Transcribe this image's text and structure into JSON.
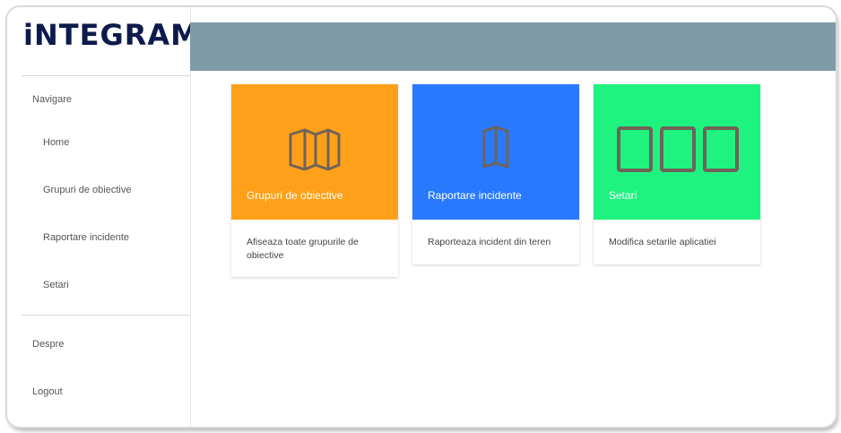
{
  "logo": {
    "text": "iNTEGRAM"
  },
  "sidebar": {
    "section_label": "Navigare",
    "items": [
      {
        "label": "Home"
      },
      {
        "label": "Grupuri de obiective"
      },
      {
        "label": "Raportare incidente"
      },
      {
        "label": "Setari"
      }
    ],
    "bottom_items": [
      {
        "label": "Despre"
      },
      {
        "label": "Logout"
      }
    ]
  },
  "cards": [
    {
      "title": "Grupuri de obiective",
      "description": "Afiseaza toate grupurile de obiective",
      "color": "#ffa01a",
      "icon": "map-icon"
    },
    {
      "title": "Raportare incidente",
      "description": "Raporteaza incident din teren",
      "color": "#2979ff",
      "icon": "map-marker-icon"
    },
    {
      "title": "Setari",
      "description": "Modifica setarile aplicatiei",
      "color": "#1ef37f",
      "icon": "grid-icon"
    }
  ],
  "colors": {
    "topbar": "#7f9aa8",
    "logo": "#0d1b4c",
    "icon_stroke": "#6f6358"
  }
}
